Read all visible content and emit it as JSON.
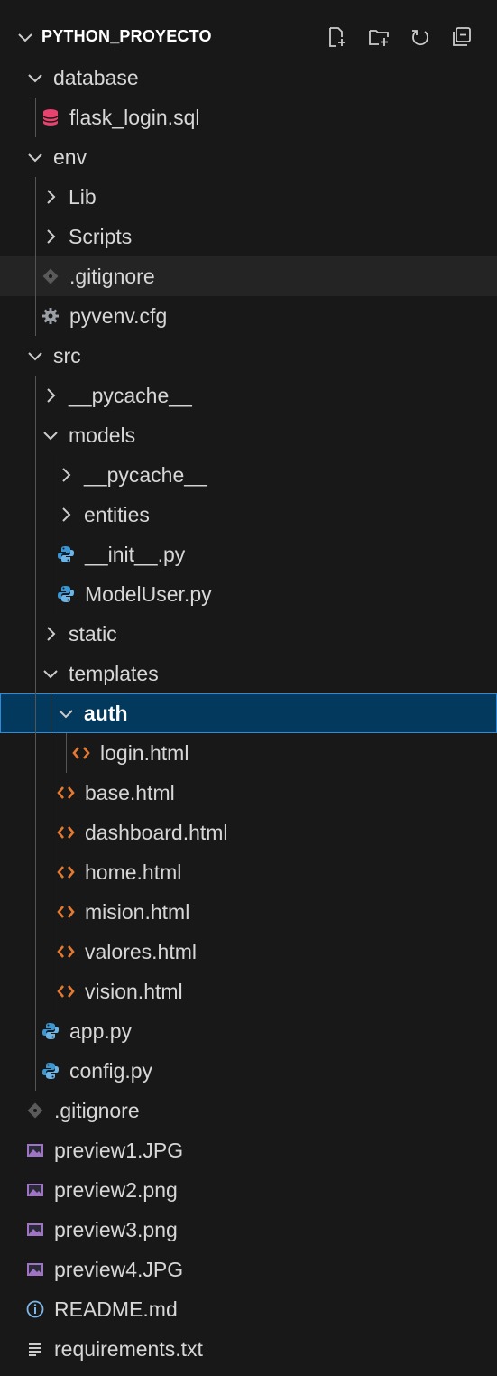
{
  "explorer": {
    "title": "PYTHON_PROYECTO",
    "actions": [
      {
        "icon": "new-file-icon"
      },
      {
        "icon": "new-folder-icon"
      },
      {
        "icon": "refresh-icon"
      },
      {
        "icon": "collapse-all-icon"
      }
    ]
  },
  "colors": {
    "background": "#181818",
    "selected_bg": "#04395e",
    "selected_border": "#2f8bd8",
    "html_icon": "#e37933",
    "python_icon": "#3b97d3",
    "sql_icon": "#e8426f",
    "image_icon": "#a074c4",
    "info_icon": "#7fb6e6"
  },
  "tree": [
    {
      "label": "database",
      "type": "folder",
      "expanded": true,
      "depth": 1
    },
    {
      "label": "flask_login.sql",
      "type": "sql",
      "depth": 2
    },
    {
      "label": "env",
      "type": "folder",
      "expanded": true,
      "depth": 1
    },
    {
      "label": "Lib",
      "type": "folder",
      "expanded": false,
      "depth": 2
    },
    {
      "label": "Scripts",
      "type": "folder",
      "expanded": false,
      "depth": 2
    },
    {
      "label": ".gitignore",
      "type": "gitignore",
      "depth": 2,
      "state": "hover"
    },
    {
      "label": "pyvenv.cfg",
      "type": "cfg",
      "depth": 2
    },
    {
      "label": "src",
      "type": "folder",
      "expanded": true,
      "depth": 1
    },
    {
      "label": "__pycache__",
      "type": "folder",
      "expanded": false,
      "depth": 2
    },
    {
      "label": "models",
      "type": "folder",
      "expanded": true,
      "depth": 2
    },
    {
      "label": "__pycache__",
      "type": "folder",
      "expanded": false,
      "depth": 3
    },
    {
      "label": "entities",
      "type": "folder",
      "expanded": false,
      "depth": 3
    },
    {
      "label": "__init__.py",
      "type": "python",
      "depth": 3
    },
    {
      "label": "ModelUser.py",
      "type": "python",
      "depth": 3
    },
    {
      "label": "static",
      "type": "folder",
      "expanded": false,
      "depth": 2
    },
    {
      "label": "templates",
      "type": "folder",
      "expanded": true,
      "depth": 2
    },
    {
      "label": "auth",
      "type": "folder",
      "expanded": true,
      "depth": 3,
      "state": "selected"
    },
    {
      "label": "login.html",
      "type": "html",
      "depth": 4
    },
    {
      "label": "base.html",
      "type": "html",
      "depth": 3
    },
    {
      "label": "dashboard.html",
      "type": "html",
      "depth": 3
    },
    {
      "label": "home.html",
      "type": "html",
      "depth": 3
    },
    {
      "label": "mision.html",
      "type": "html",
      "depth": 3
    },
    {
      "label": "valores.html",
      "type": "html",
      "depth": 3
    },
    {
      "label": "vision.html",
      "type": "html",
      "depth": 3
    },
    {
      "label": "app.py",
      "type": "python",
      "depth": 2
    },
    {
      "label": "config.py",
      "type": "python",
      "depth": 2
    },
    {
      "label": ".gitignore",
      "type": "gitignore",
      "depth": 1
    },
    {
      "label": "preview1.JPG",
      "type": "image",
      "depth": 1
    },
    {
      "label": "preview2.png",
      "type": "image",
      "depth": 1
    },
    {
      "label": "preview3.png",
      "type": "image",
      "depth": 1
    },
    {
      "label": "preview4.JPG",
      "type": "image",
      "depth": 1
    },
    {
      "label": "README.md",
      "type": "info",
      "depth": 1
    },
    {
      "label": "requirements.txt",
      "type": "text",
      "depth": 1
    }
  ]
}
